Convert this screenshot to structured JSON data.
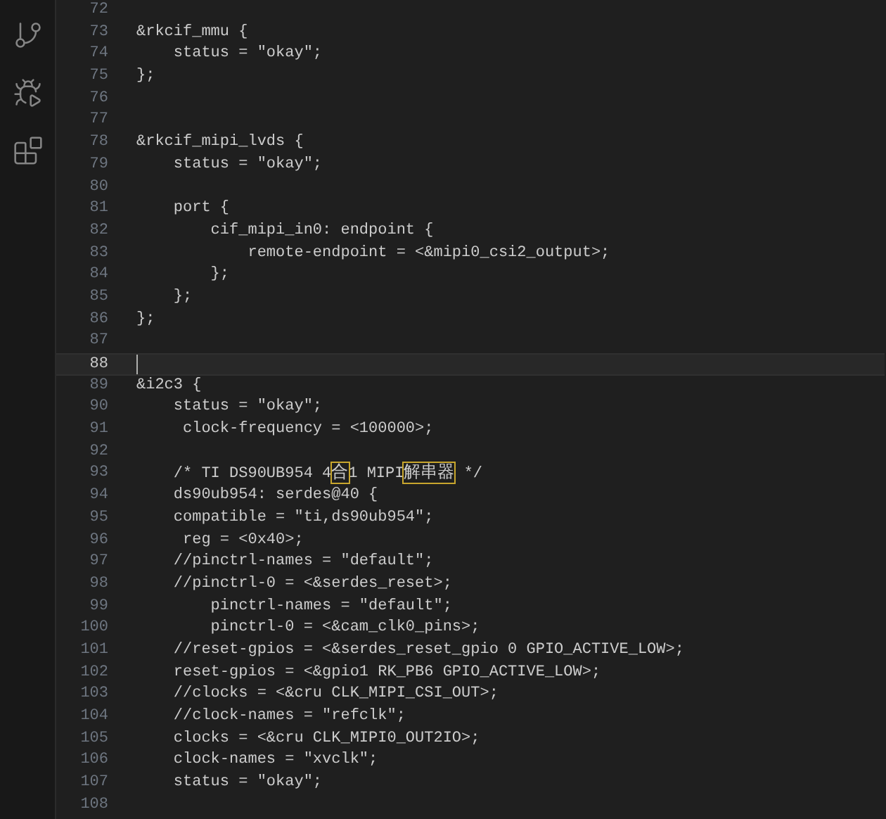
{
  "activity_bar": [
    {
      "kind": "source-control"
    },
    {
      "kind": "run-debug"
    },
    {
      "kind": "extensions"
    }
  ],
  "lines": [
    {
      "number": "72",
      "current": false
    },
    {
      "number": "73",
      "text": "&rkcif_mmu {",
      "current": false
    },
    {
      "number": "74",
      "text": "    status = \"okay\";",
      "current": false
    },
    {
      "number": "75",
      "text": "};",
      "current": false
    },
    {
      "number": "76",
      "current": false
    },
    {
      "number": "77",
      "current": false
    },
    {
      "number": "78",
      "text": "&rkcif_mipi_lvds {",
      "current": false
    },
    {
      "number": "79",
      "text": "    status = \"okay\";",
      "current": false
    },
    {
      "number": "80",
      "current": false
    },
    {
      "number": "81",
      "text": "    port {",
      "current": false
    },
    {
      "number": "82",
      "text": "        cif_mipi_in0: endpoint {",
      "current": false
    },
    {
      "number": "83",
      "text": "            remote-endpoint = <&mipi0_csi2_output>;",
      "current": false
    },
    {
      "number": "84",
      "text": "        };",
      "current": false
    },
    {
      "number": "85",
      "text": "    };",
      "current": false
    },
    {
      "number": "86",
      "text": "};",
      "current": false
    },
    {
      "number": "87",
      "current": false
    },
    {
      "number": "88",
      "current": true
    },
    {
      "number": "89",
      "text": "&i2c3 {",
      "current": false
    },
    {
      "number": "90",
      "text": "    status = \"okay\";",
      "current": false
    },
    {
      "number": "91",
      "text": "     clock-frequency = <100000>;",
      "current": false
    },
    {
      "number": "92",
      "current": false
    },
    {
      "number": "93",
      "segments": [
        {
          "text": "    /* TI DS90UB954 4",
          "highlighted": false
        },
        {
          "text": "合",
          "highlighted": true
        },
        {
          "text": "1 MIPI",
          "highlighted": false
        },
        {
          "text": "解串器",
          "highlighted": true
        },
        {
          "text": " */",
          "highlighted": false
        }
      ],
      "current": false
    },
    {
      "number": "94",
      "text": "    ds90ub954: serdes@40 {",
      "current": false
    },
    {
      "number": "95",
      "text": "    compatible = \"ti,ds90ub954\";",
      "current": false
    },
    {
      "number": "96",
      "text": "     reg = <0x40>;",
      "current": false
    },
    {
      "number": "97",
      "text": "    //pinctrl-names = \"default\";",
      "current": false
    },
    {
      "number": "98",
      "text": "    //pinctrl-0 = <&serdes_reset>;",
      "current": false
    },
    {
      "number": "99",
      "text": "        pinctrl-names = \"default\";",
      "current": false
    },
    {
      "number": "100",
      "text": "        pinctrl-0 = <&cam_clk0_pins>;",
      "current": false
    },
    {
      "number": "101",
      "text": "    //reset-gpios = <&serdes_reset_gpio 0 GPIO_ACTIVE_LOW>;",
      "current": false
    },
    {
      "number": "102",
      "text": "    reset-gpios = <&gpio1 RK_PB6 GPIO_ACTIVE_LOW>;",
      "current": false
    },
    {
      "number": "103",
      "text": "    //clocks = <&cru CLK_MIPI_CSI_OUT>;",
      "current": false
    },
    {
      "number": "104",
      "text": "    //clock-names = \"refclk\";",
      "current": false
    },
    {
      "number": "105",
      "text": "    clocks = <&cru CLK_MIPI0_OUT2IO>;",
      "current": false
    },
    {
      "number": "106",
      "text": "    clock-names = \"xvclk\";",
      "current": false
    },
    {
      "number": "107",
      "text": "    status = \"okay\";",
      "current": false
    },
    {
      "number": "108",
      "current": false
    }
  ]
}
